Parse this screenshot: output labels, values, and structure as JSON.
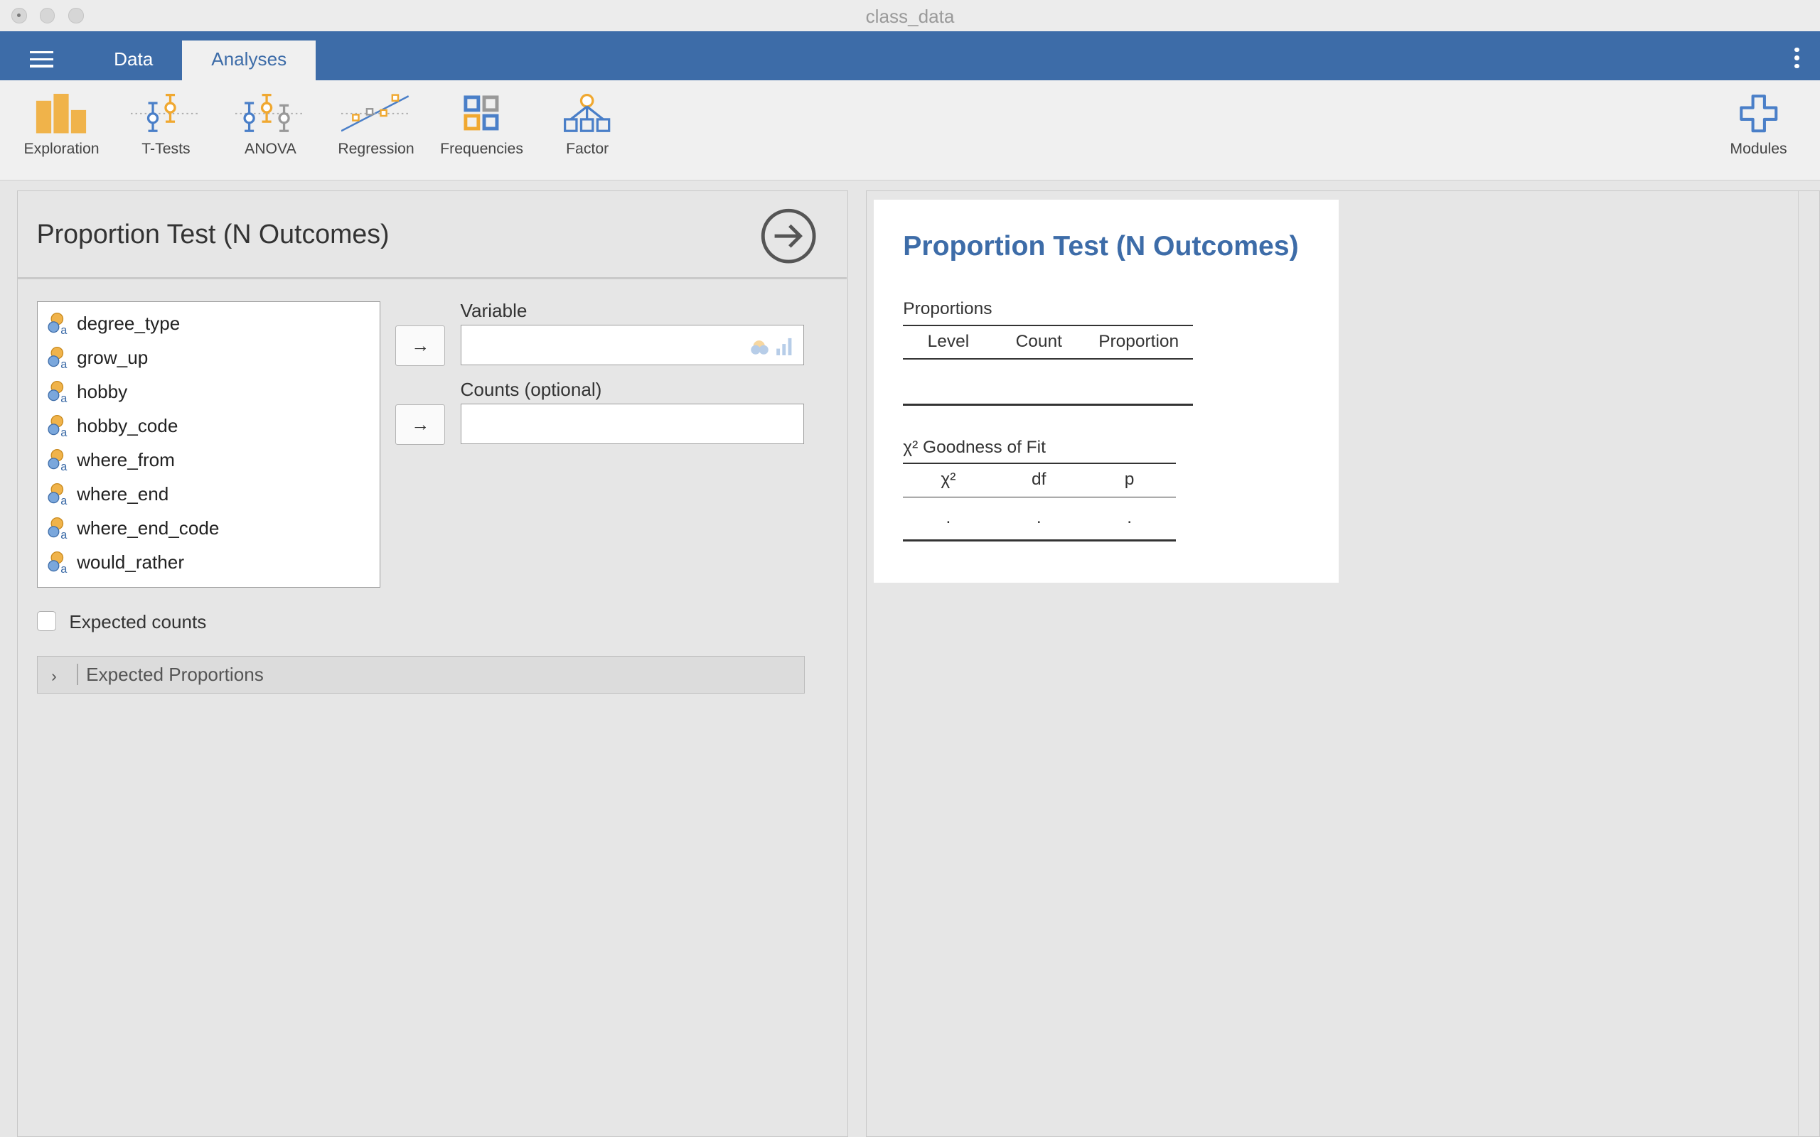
{
  "window": {
    "title": "class_data"
  },
  "tabs": {
    "data": "Data",
    "analyses": "Analyses"
  },
  "ribbon": [
    {
      "label": "Exploration",
      "icon": "exploration-icon"
    },
    {
      "label": "T-Tests",
      "icon": "t-tests-icon"
    },
    {
      "label": "ANOVA",
      "icon": "anova-icon"
    },
    {
      "label": "Regression",
      "icon": "regression-icon"
    },
    {
      "label": "Frequencies",
      "icon": "frequencies-icon"
    },
    {
      "label": "Factor",
      "icon": "factor-icon"
    },
    {
      "label": "Modules",
      "icon": "plus-icon"
    }
  ],
  "options_panel": {
    "title": "Proportion Test (N Outcomes)",
    "variables": [
      "degree_type",
      "grow_up",
      "hobby",
      "hobby_code",
      "where_from",
      "where_end",
      "where_end_code",
      "would_rather"
    ],
    "variable_label": "Variable",
    "variable_value": "",
    "counts_label": "Counts (optional)",
    "counts_value": "",
    "expected_counts_label": "Expected counts",
    "expected_counts_checked": false,
    "expected_proportions_label": "Expected Proportions",
    "arrow_glyph": "→",
    "chevron_glyph": "›"
  },
  "results": {
    "title": "Proportion Test (N Outcomes)",
    "proportions_table": {
      "title": "Proportions",
      "columns": [
        "Level",
        "Count",
        "Proportion"
      ]
    },
    "gof_table": {
      "title": "χ² Goodness of Fit",
      "columns": [
        "χ²",
        "df",
        "p"
      ],
      "row": [
        ".",
        ".",
        "."
      ]
    }
  },
  "colors": {
    "accent": "#3d6ca8",
    "nominal_icon": "#f0a830",
    "ribbon_blue": "#4a7fc8"
  }
}
